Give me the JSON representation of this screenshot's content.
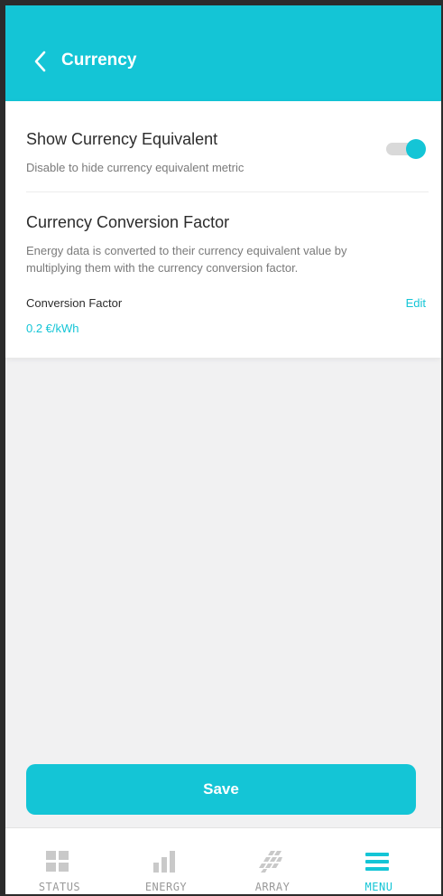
{
  "header": {
    "title": "Currency"
  },
  "show_currency": {
    "title": "Show Currency Equivalent",
    "description": "Disable to hide currency equivalent metric",
    "enabled": true
  },
  "conversion": {
    "title": "Currency Conversion Factor",
    "description_line1": "Energy data is converted to their currency equivalent value by",
    "description_line2": "multiplying them with the currency conversion factor.",
    "factor_label": "Conversion Factor",
    "edit_label": "Edit",
    "factor_value": "0.2 €/kWh"
  },
  "save_label": "Save",
  "nav": {
    "items": [
      {
        "label": "STATUS",
        "icon": "grid-icon"
      },
      {
        "label": "ENERGY",
        "icon": "bar-chart-icon"
      },
      {
        "label": "ARRAY",
        "icon": "solar-array-icon"
      },
      {
        "label": "MENU",
        "icon": "hamburger-icon",
        "active": true
      }
    ]
  },
  "colors": {
    "accent": "#14c5d6",
    "background": "#f1f1f2"
  }
}
